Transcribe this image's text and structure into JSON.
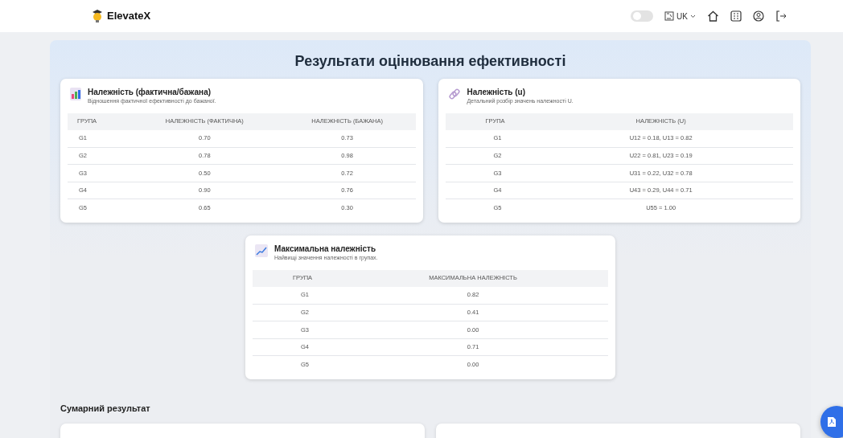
{
  "navbar": {
    "brand": "ElevateX",
    "theme_toggle": {
      "on": false
    },
    "language": "UK"
  },
  "title": "Результати оцінювання ефективності",
  "cards": [
    {
      "title": "Належність (фактична/бажана)",
      "subtitle": "Відношення фактичної ефективності до бажаної.",
      "columns": [
        "ГРУПА",
        "НАЛЕЖНІСТЬ (ФАКТИЧНА)",
        "НАЛЕЖНІСТЬ (БАЖАНА)"
      ],
      "rows": [
        [
          "G1",
          "0.70",
          "0.73"
        ],
        [
          "G2",
          "0.78",
          "0.98"
        ],
        [
          "G3",
          "0.50",
          "0.72"
        ],
        [
          "G4",
          "0.90",
          "0.76"
        ],
        [
          "G5",
          "0.65",
          "0.30"
        ]
      ]
    },
    {
      "title": "Належність (u)",
      "subtitle": "Детальний розбір значень належності U.",
      "columns": [
        "ГРУПА",
        "НАЛЕЖНІСТЬ (U)"
      ],
      "rows": [
        [
          "G1",
          "U12 = 0.18, U13 = 0.82"
        ],
        [
          "G2",
          "U22 = 0.81, U23 = 0.19"
        ],
        [
          "G3",
          "U31 = 0.22, U32 = 0.78"
        ],
        [
          "G4",
          "U43 = 0.29, U44 = 0.71"
        ],
        [
          "G5",
          "U55 = 1.00"
        ]
      ]
    },
    {
      "title": "Максимальна належність",
      "subtitle": "Найвищі значення належності в групах.",
      "columns": [
        "ГРУПА",
        "МАКСИМАЛЬНА НАЛЕЖНІСТЬ"
      ],
      "rows": [
        [
          "G1",
          "0.82"
        ],
        [
          "G2",
          "0.41"
        ],
        [
          "G3",
          "0.00"
        ],
        [
          "G4",
          "0.71"
        ],
        [
          "G5",
          "0.00"
        ]
      ]
    }
  ],
  "summary": {
    "heading": "Сумарний результат"
  }
}
